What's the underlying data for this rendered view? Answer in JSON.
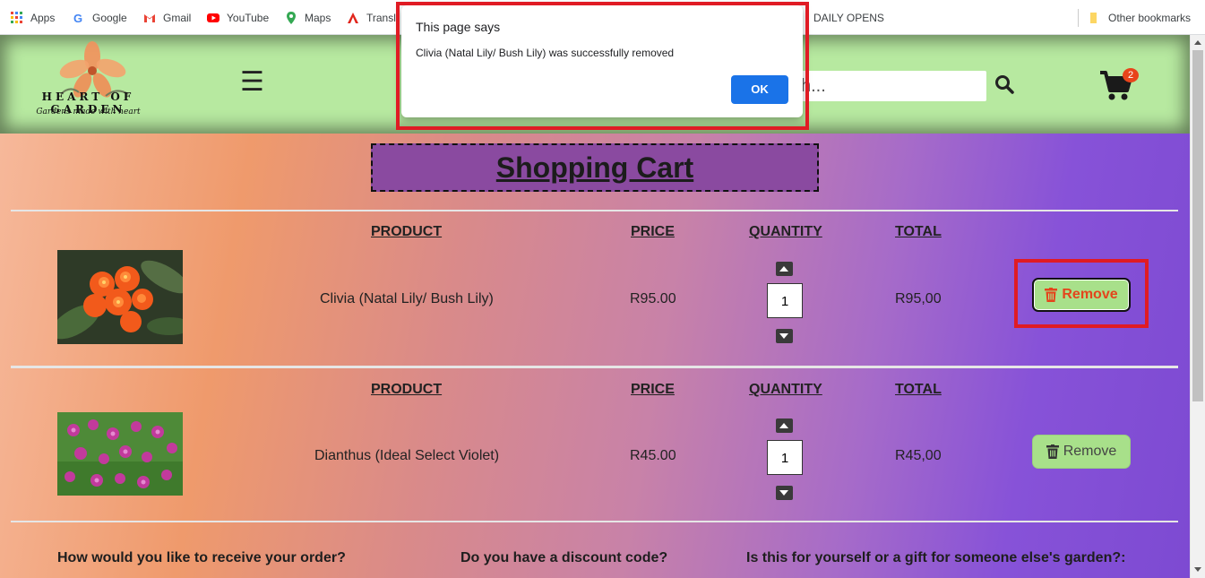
{
  "bookmarks": {
    "items": [
      {
        "label": "Apps",
        "icon": "apps-grid-icon"
      },
      {
        "label": "Google",
        "icon": "google-icon"
      },
      {
        "label": "Gmail",
        "icon": "gmail-icon"
      },
      {
        "label": "YouTube",
        "icon": "youtube-icon"
      },
      {
        "label": "Maps",
        "icon": "maps-icon"
      },
      {
        "label": "Transl",
        "icon": "acrobat-icon"
      },
      {
        "label": "DAILY OPENS",
        "icon": "folder-icon"
      }
    ],
    "other": "Other bookmarks"
  },
  "header": {
    "logo_title": "HEART OF GARDEN",
    "logo_subtitle": "Gardens made with heart",
    "search_placeholder": "Search...",
    "search_visible": "h...",
    "cart_count": "2"
  },
  "cart": {
    "title": "Shopping Cart",
    "columns": {
      "product": "PRODUCT",
      "price": "PRICE",
      "quantity": "QUANTITY",
      "total": "TOTAL"
    },
    "remove_label": "Remove",
    "items": [
      {
        "name": "Clivia (Natal Lily/ Bush Lily)",
        "price": "R95.00",
        "quantity": "1",
        "total": "R95,00"
      },
      {
        "name": "Dianthus (Ideal Select Violet)",
        "price": "R45.00",
        "quantity": "1",
        "total": "R45,00"
      }
    ]
  },
  "questions": {
    "delivery": "How would you like to receive your order?",
    "discount": "Do you have a discount code?",
    "gift": "Is this for yourself or a gift for someone else's garden?:"
  },
  "dialog": {
    "title": "This page says",
    "message": "Clivia (Natal Lily/ Bush Lily) was successfully removed",
    "ok_label": "OK"
  },
  "colors": {
    "header_bg": "#b7e9a0",
    "remove_bg": "#a8e08a",
    "highlight": "#e01b24",
    "dialog_button": "#1a73e8"
  }
}
